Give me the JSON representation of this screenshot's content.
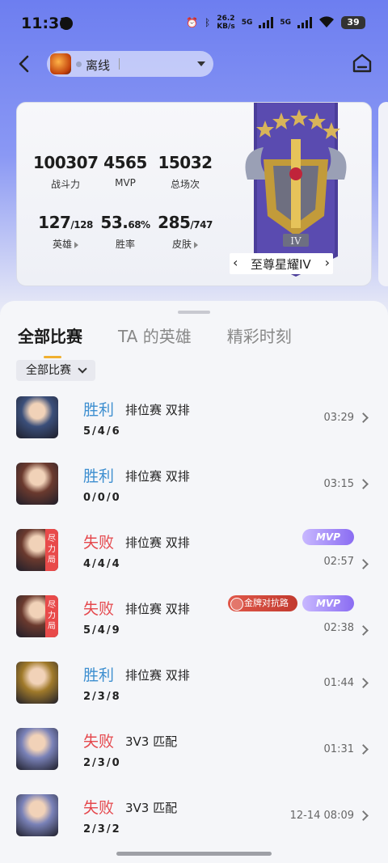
{
  "status_bar": {
    "time": "11:31",
    "net_speed_value": "26.2",
    "net_speed_unit": "KB/s",
    "net_label_1": "5G",
    "net_label_2": "5G",
    "battery": "39"
  },
  "header": {
    "status": "离线"
  },
  "stats": {
    "combat_power": {
      "value": "100307",
      "label": "战斗力"
    },
    "mvp": {
      "value": "4565",
      "label": "MVP"
    },
    "total_matches": {
      "value": "15032",
      "label": "总场次"
    },
    "heroes": {
      "value": "127",
      "total": "/128",
      "label": "英雄"
    },
    "win_rate": {
      "value": "53.",
      "suffix": "68%",
      "label": "胜率"
    },
    "skins": {
      "value": "285",
      "total": "/747",
      "label": "皮肤"
    },
    "rank_label": "至尊星耀IV",
    "rank_numeral": "IV"
  },
  "tabs": [
    {
      "label": "全部比赛",
      "active": true
    },
    {
      "label": "TA 的英雄",
      "active": false
    },
    {
      "label": "精彩时刻",
      "active": false
    }
  ],
  "filter_label": "全部比赛",
  "badges": {
    "mvp": "MVP",
    "gold_lane": "金牌对抗路",
    "full_effort": "尽力局"
  },
  "matches": [
    {
      "result": "胜利",
      "win": true,
      "mode": "排位赛 双排",
      "kda": "5/4/6",
      "duration": "03:29",
      "mvp": false,
      "gold": false,
      "full_effort": false,
      "hero_color": "#3b4f7a"
    },
    {
      "result": "胜利",
      "win": true,
      "mode": "排位赛 双排",
      "kda": "0/0/0",
      "duration": "03:15",
      "mvp": false,
      "gold": false,
      "full_effort": false,
      "hero_color": "#6b3a2e"
    },
    {
      "result": "失败",
      "win": false,
      "mode": "排位赛 双排",
      "kda": "4/4/4",
      "duration": "02:57",
      "mvp": true,
      "gold": false,
      "full_effort": true,
      "hero_color": "#6b3a2e"
    },
    {
      "result": "失败",
      "win": false,
      "mode": "排位赛 双排",
      "kda": "5/4/9",
      "duration": "02:38",
      "mvp": true,
      "gold": true,
      "full_effort": true,
      "hero_color": "#6b3a2e"
    },
    {
      "result": "胜利",
      "win": true,
      "mode": "排位赛 双排",
      "kda": "2/3/8",
      "duration": "01:44",
      "mvp": false,
      "gold": false,
      "full_effort": false,
      "hero_color": "#a07a2a"
    },
    {
      "result": "失败",
      "win": false,
      "mode": "3V3 匹配",
      "kda": "2/3/0",
      "duration": "01:31",
      "mvp": false,
      "gold": false,
      "full_effort": false,
      "hero_color": "#7a82b8"
    },
    {
      "result": "失败",
      "win": false,
      "mode": "3V3 匹配",
      "kda": "2/3/2",
      "duration": "12-14 08:09",
      "mvp": false,
      "gold": false,
      "full_effort": false,
      "hero_color": "#7a82b8"
    }
  ]
}
